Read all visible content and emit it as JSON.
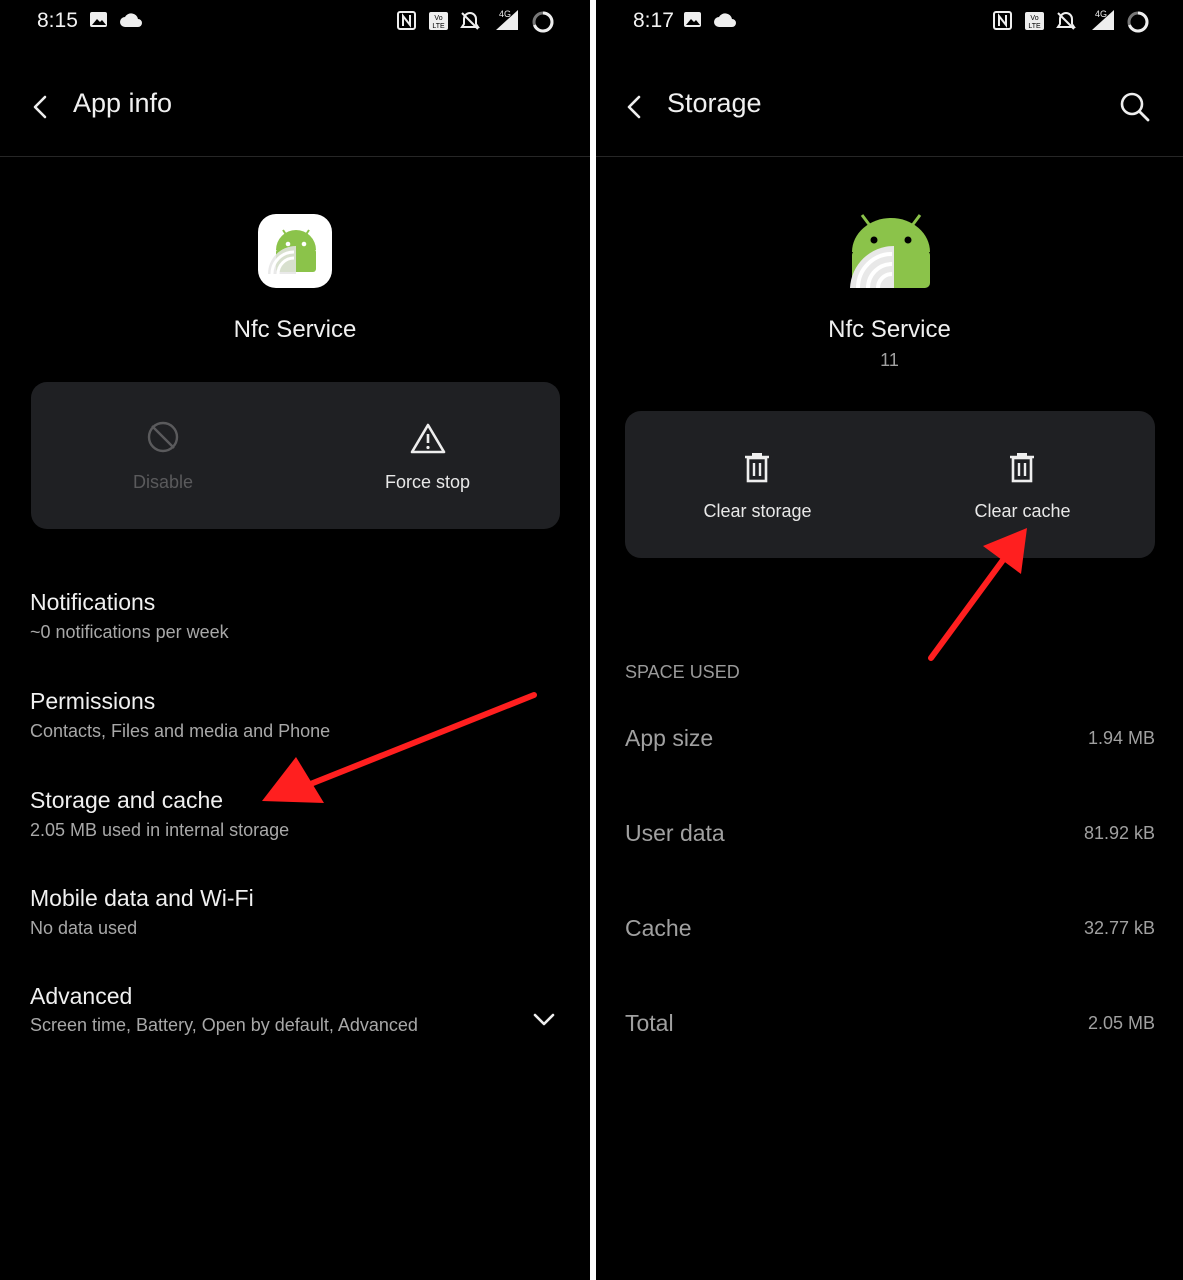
{
  "left": {
    "status_time": "8:15",
    "header_title": "App info",
    "app_name": "Nfc Service",
    "actions": [
      {
        "label": "Disable",
        "icon": "disable-icon",
        "enabled": false
      },
      {
        "label": "Force stop",
        "icon": "warning-icon",
        "enabled": true
      }
    ],
    "settings": [
      {
        "title": "Notifications",
        "subtitle": "~0 notifications per week"
      },
      {
        "title": "Permissions",
        "subtitle": "Contacts, Files and media and Phone"
      },
      {
        "title": "Storage and cache",
        "subtitle": "2.05 MB used in internal storage"
      },
      {
        "title": "Mobile data and Wi-Fi",
        "subtitle": "No data used"
      },
      {
        "title": "Advanced",
        "subtitle": "Screen time, Battery, Open by default, Advanced"
      }
    ]
  },
  "right": {
    "status_time": "8:17",
    "header_title": "Storage",
    "app_name": "Nfc Service",
    "app_version": "11",
    "actions": [
      {
        "label": "Clear storage",
        "icon": "trash-icon"
      },
      {
        "label": "Clear cache",
        "icon": "trash-icon"
      }
    ],
    "section_header": "SPACE USED",
    "space_used": [
      {
        "label": "App size",
        "value": "1.94 MB"
      },
      {
        "label": "User data",
        "value": "81.92 kB"
      },
      {
        "label": "Cache",
        "value": "32.77 kB"
      },
      {
        "label": "Total",
        "value": "2.05 MB"
      }
    ]
  },
  "status_icons": [
    "image-icon",
    "cloud-icon",
    "nfc-icon",
    "volte-icon",
    "bell-off-icon",
    "signal-4g-icon",
    "battery-ring-icon"
  ],
  "colors": {
    "background": "#000000",
    "card": "#1f2023",
    "annotation_arrow": "#ff1f1f",
    "android_green": "#8bc34a"
  }
}
